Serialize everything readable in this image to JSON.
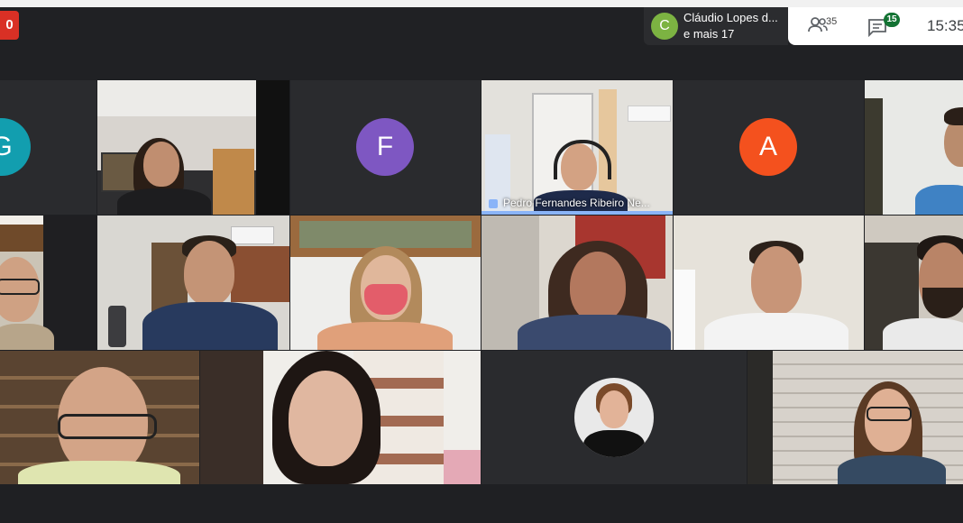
{
  "header": {
    "recording_label": "0",
    "presenter": {
      "avatar_letter": "C",
      "avatar_color": "#7cb342",
      "name": "Cláudio Lopes d...",
      "more": "e mais 17"
    },
    "participants_count": "35",
    "chat_badge": "15",
    "time": "15:35"
  },
  "tiles": [
    {
      "type": "letter",
      "letter": "G",
      "color": "#129eaf"
    },
    {
      "type": "video",
      "scene": "office-woman"
    },
    {
      "type": "letter",
      "letter": "F",
      "color": "#7e57c2"
    },
    {
      "type": "video",
      "scene": "man-headset",
      "caption": "Pedro Fernandes Ribeiro Ne...",
      "speaking": true
    },
    {
      "type": "letter",
      "letter": "A",
      "color": "#f4511e"
    },
    {
      "type": "video",
      "scene": "man-right"
    },
    {
      "type": "video",
      "scene": "man-glasses-left"
    },
    {
      "type": "video",
      "scene": "man-thinking"
    },
    {
      "type": "video",
      "scene": "woman-mask"
    },
    {
      "type": "video",
      "scene": "woman-shelf"
    },
    {
      "type": "video",
      "scene": "man-smiling"
    },
    {
      "type": "video",
      "scene": "man-beard"
    },
    {
      "type": "video",
      "scene": "man-bookshelf"
    },
    {
      "type": "video",
      "scene": "woman-dark-hair"
    },
    {
      "type": "photo",
      "scene": "woman-profile-photo"
    },
    {
      "type": "video",
      "scene": "woman-glasses"
    }
  ]
}
